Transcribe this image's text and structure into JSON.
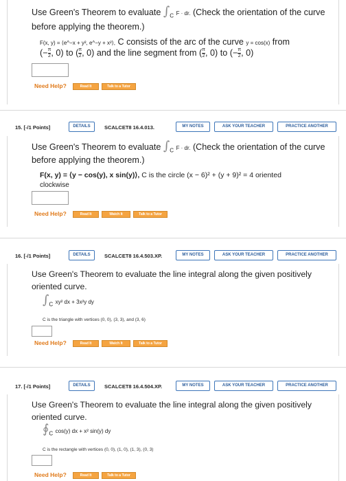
{
  "common": {
    "intro_text": "Use Green's Theorem to evaluate",
    "fdr": "F · dr.",
    "check_orientation": "(Check the orientation of the curve",
    "before_applying": "before applying the theorem.)",
    "need_help": "Need Help?",
    "read_it": "Read It",
    "watch_it": "Watch It",
    "talk_tutor": "Talk to a Tutor",
    "details": "DETAILS",
    "my_notes": "MY NOTES",
    "ask_teacher": "ASK YOUR TEACHER",
    "practice_another": "PRACTICE ANOTHER",
    "points": "[-/1 Points]"
  },
  "q14": {
    "F": "F(x, y) = ⟨e^−x + y², e^−y + x²⟩,",
    "c_text": "C consists of the arc of the curve",
    "curve": "y = cos(x)",
    "from": "from",
    "to": "to",
    "and_seg": "and the line segment from",
    "to2": "to"
  },
  "q15": {
    "number": "15.",
    "code": "SCALCET8 16.4.013.",
    "F": "F(x, y) = ⟨y − cos(y), x sin(y)⟩,",
    "circle": "C is the circle (x − 6)² + (y + 9)² = 4 oriented",
    "clockwise": "clockwise"
  },
  "q16": {
    "number": "16.",
    "code": "SCALCET8 16.4.503.XP.",
    "line1": "Use Green's Theorem to evaluate the line integral along the given positively",
    "line2": "oriented curve.",
    "integrand": "xy² dx + 3x²y dy",
    "curve": "C is the triangle with vertices (0, 0), (3, 3), and (3, 6)"
  },
  "q17": {
    "number": "17.",
    "code": "SCALCET8 16.4.504.XP.",
    "line1": "Use Green's Theorem to evaluate the line integral along the given positively",
    "line2": "oriented curve.",
    "integrand": "cos(y) dx + x² sin(y) dy",
    "curve": "C is the rectangle with vertices (0, 0), (1, 0), (1, 3), (0, 3)"
  }
}
